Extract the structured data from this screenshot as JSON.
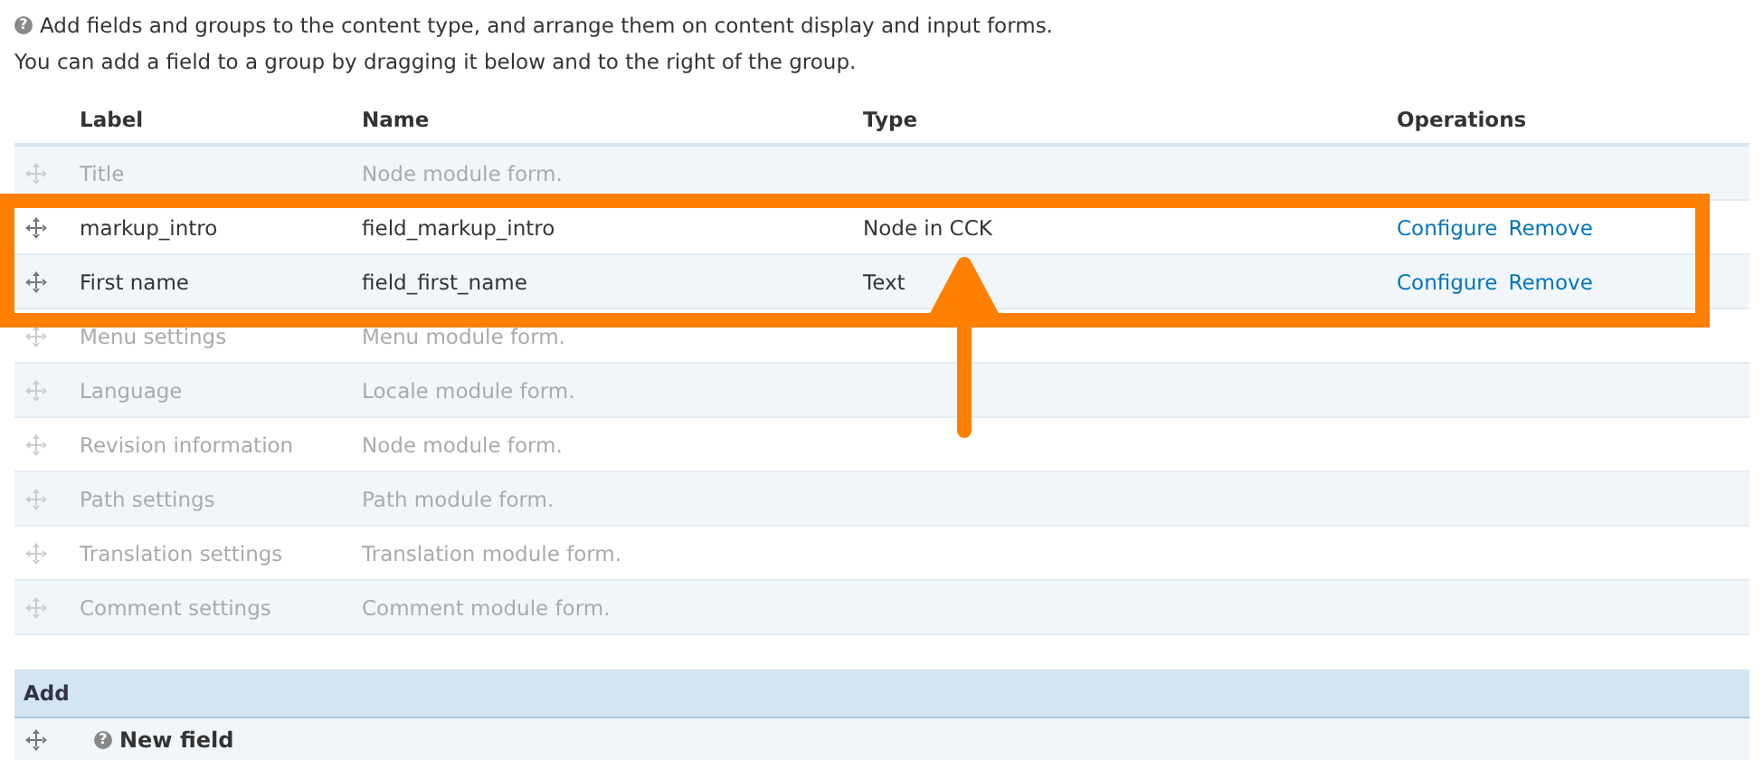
{
  "help": {
    "icon": "?",
    "lines": [
      "Add fields and groups to the content type, and arrange them on content display and input forms.",
      "You can add a field to a group by dragging it below and to the right of the group."
    ]
  },
  "table": {
    "columns": [
      "Label",
      "Name",
      "Type",
      "Operations"
    ],
    "rows": [
      {
        "label": "Title",
        "name": "Node module form.",
        "disabled": true
      },
      {
        "label": "markup_intro",
        "name": "field_markup_intro",
        "type": "Node in CCK",
        "operations": [
          "Configure",
          "Remove"
        ],
        "disabled": false
      },
      {
        "label": "First name",
        "name": "field_first_name",
        "type": "Text",
        "operations": [
          "Configure",
          "Remove"
        ],
        "disabled": false
      },
      {
        "label": "Menu settings",
        "name": "Menu module form.",
        "disabled": true
      },
      {
        "label": "Language",
        "name": "Locale module form.",
        "disabled": true
      },
      {
        "label": "Revision information",
        "name": "Node module form.",
        "disabled": true
      },
      {
        "label": "Path settings",
        "name": "Path module form.",
        "disabled": true
      },
      {
        "label": "Translation settings",
        "name": "Translation module form.",
        "disabled": true
      },
      {
        "label": "Comment settings",
        "name": "Comment module form.",
        "disabled": true
      }
    ]
  },
  "add": {
    "heading": "Add",
    "row": {
      "icon": "?",
      "label": "New field"
    }
  },
  "annotation": {
    "color": "#ff7f00"
  }
}
